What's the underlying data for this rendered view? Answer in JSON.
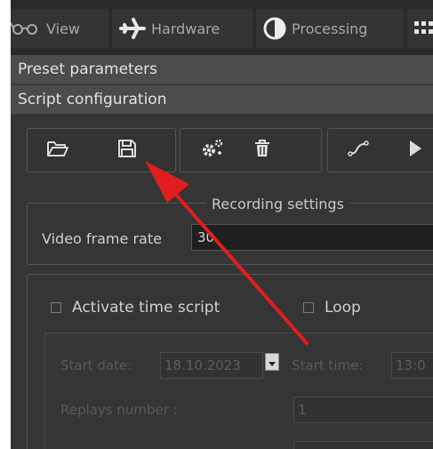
{
  "tabs": [
    {
      "label": "View",
      "icon": "glasses-icon"
    },
    {
      "label": "Hardware",
      "icon": "airplane-icon"
    },
    {
      "label": "Processing",
      "icon": "contrast-icon"
    },
    {
      "label": "",
      "icon": "grid-icon"
    }
  ],
  "sections": {
    "preset": "Preset parameters",
    "script": "Script configuration"
  },
  "toolbar": {
    "open_icon": "folder-open-icon",
    "save_icon": "save-icon",
    "settings_icon": "gears-icon",
    "delete_icon": "trash-icon",
    "curve_icon": "curve-icon",
    "play_icon": "play-icon"
  },
  "recording": {
    "title": "Recording settings",
    "video_frame_rate_label": "Video frame rate",
    "video_frame_rate_value": "30"
  },
  "time_script": {
    "activate_label": "Activate time script",
    "loop_label": "Loop",
    "start_date_label": "Start date:",
    "start_date_value": "18.10.2023",
    "start_time_label": "Start time:",
    "start_time_value": "13:0",
    "replays_label": "Replays number :",
    "replays_value": "1"
  },
  "colors": {
    "annotation_arrow": "#e01e1e",
    "header_bg": "#4c4c4c",
    "panel_bg": "#353535"
  }
}
